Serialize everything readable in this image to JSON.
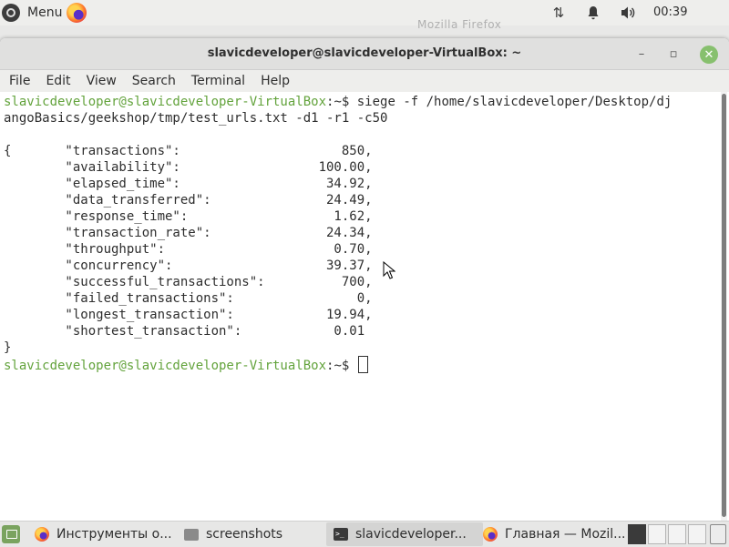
{
  "top_panel": {
    "menu_label": "Menu",
    "ghost_title": "Mozilla Firefox",
    "clock": "00:39",
    "tray_icons": [
      "network-updown-icon",
      "notifications-bell-icon",
      "volume-icon"
    ]
  },
  "window": {
    "title": "slavicdeveloper@slavicdeveloper-VirtualBox: ~",
    "buttons": {
      "minimize": "–",
      "maximize": "▫",
      "close": "✕"
    }
  },
  "menubar": [
    "File",
    "Edit",
    "View",
    "Search",
    "Terminal",
    "Help"
  ],
  "terminal": {
    "prompt_user": "slavicdeveloper@slavicdeveloper-VirtualBox",
    "prompt_path": ":~",
    "prompt_symbol": "$",
    "command_line1": " siege -f /home/slavicdeveloper/Desktop/dj",
    "command_line2": "angoBasics/geekshop/tmp/test_urls.txt -d1 -r1 -c50",
    "blank": "",
    "output": [
      "{       \"transactions\":                     850,",
      "        \"availability\":                  100.00,",
      "        \"elapsed_time\":                   34.92,",
      "        \"data_transferred\":               24.49,",
      "        \"response_time\":                   1.62,",
      "        \"transaction_rate\":               24.34,",
      "        \"throughput\":                      0.70,",
      "        \"concurrency\":                    39.37,",
      "        \"successful_transactions\":          700,",
      "        \"failed_transactions\":                0,",
      "        \"longest_transaction\":            19.94,",
      "        \"shortest_transaction\":            0.01",
      "}"
    ],
    "final_prompt_suffix": " "
  },
  "taskbar": {
    "tasks": [
      {
        "label": "Инструменты о...",
        "icon": "firefox-icon"
      },
      {
        "label": "screenshots",
        "icon": "folder-icon"
      },
      {
        "label": "slavicdeveloper...",
        "icon": "terminal-icon"
      },
      {
        "label": "Главная — Mozil...",
        "icon": "firefox-icon"
      }
    ],
    "workspaces": 4
  },
  "colors": {
    "prompt": "#63a33c",
    "close_button": "#87c06e",
    "terminal_text": "#2e2e2e"
  }
}
